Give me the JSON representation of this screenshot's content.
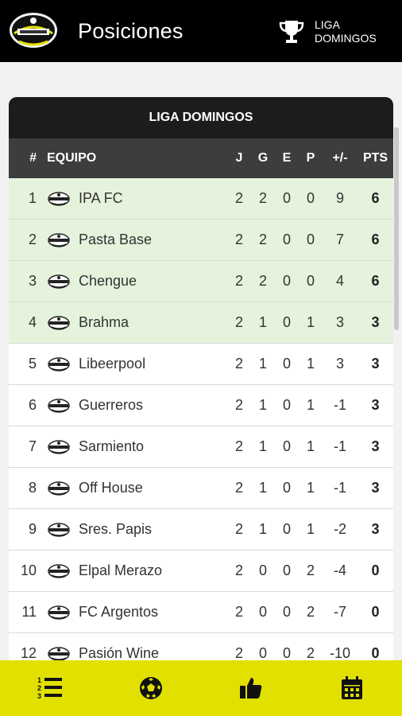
{
  "header": {
    "title": "Posiciones",
    "league_label": "LIGA\nDOMINGOS"
  },
  "standings": {
    "card_title": "LIGA DOMINGOS",
    "columns": {
      "pos": "#",
      "team": "EQUIPO",
      "played": "J",
      "won": "G",
      "drawn": "E",
      "lost": "P",
      "diff": "+/-",
      "points": "PTS"
    },
    "rows": [
      {
        "pos": "1",
        "team": "IPA FC",
        "j": "2",
        "g": "2",
        "e": "0",
        "p": "0",
        "dif": "9",
        "pts": "6"
      },
      {
        "pos": "2",
        "team": "Pasta Base",
        "j": "2",
        "g": "2",
        "e": "0",
        "p": "0",
        "dif": "7",
        "pts": "6"
      },
      {
        "pos": "3",
        "team": "Chengue",
        "j": "2",
        "g": "2",
        "e": "0",
        "p": "0",
        "dif": "4",
        "pts": "6"
      },
      {
        "pos": "4",
        "team": "Brahma",
        "j": "2",
        "g": "1",
        "e": "0",
        "p": "1",
        "dif": "3",
        "pts": "3"
      },
      {
        "pos": "5",
        "team": "Libeerpool",
        "j": "2",
        "g": "1",
        "e": "0",
        "p": "1",
        "dif": "3",
        "pts": "3"
      },
      {
        "pos": "6",
        "team": "Guerreros",
        "j": "2",
        "g": "1",
        "e": "0",
        "p": "1",
        "dif": "-1",
        "pts": "3"
      },
      {
        "pos": "7",
        "team": "Sarmiento",
        "j": "2",
        "g": "1",
        "e": "0",
        "p": "1",
        "dif": "-1",
        "pts": "3"
      },
      {
        "pos": "8",
        "team": "Off House",
        "j": "2",
        "g": "1",
        "e": "0",
        "p": "1",
        "dif": "-1",
        "pts": "3"
      },
      {
        "pos": "9",
        "team": "Sres. Papis",
        "j": "2",
        "g": "1",
        "e": "0",
        "p": "1",
        "dif": "-2",
        "pts": "3"
      },
      {
        "pos": "10",
        "team": "Elpal Merazo",
        "j": "2",
        "g": "0",
        "e": "0",
        "p": "2",
        "dif": "-4",
        "pts": "0"
      },
      {
        "pos": "11",
        "team": "FC Argentos",
        "j": "2",
        "g": "0",
        "e": "0",
        "p": "2",
        "dif": "-7",
        "pts": "0"
      },
      {
        "pos": "12",
        "team": "Pasión Wine",
        "j": "2",
        "g": "0",
        "e": "0",
        "p": "2",
        "dif": "-10",
        "pts": "0"
      }
    ]
  },
  "bottom_nav": [
    {
      "icon": "list-ordered-icon"
    },
    {
      "icon": "soccer-ball-icon"
    },
    {
      "icon": "thumbs-up-icon"
    },
    {
      "icon": "calendar-icon"
    }
  ],
  "colors": {
    "header_bg": "#000000",
    "nav_bg": "#e2e000",
    "qualified_row": "#e5f3dc",
    "table_header": "#3d3d3d",
    "card_title_bg": "#1c1c1c"
  }
}
